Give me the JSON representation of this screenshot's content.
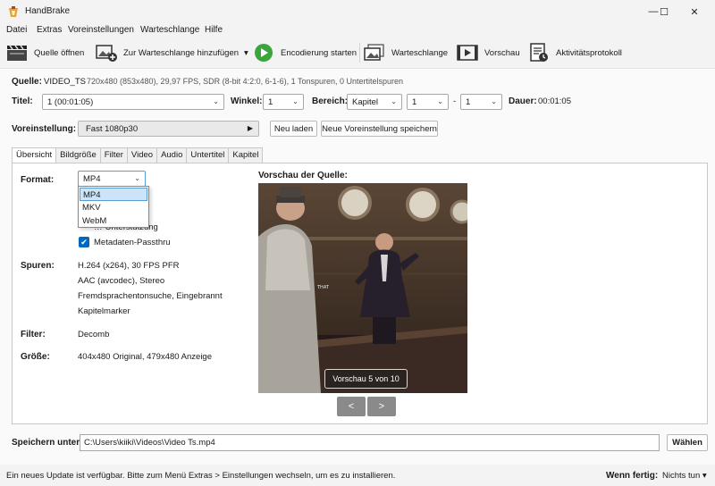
{
  "window": {
    "title": "HandBrake",
    "controls": {
      "minimize": "—",
      "maximize": "☐",
      "close": "✕"
    }
  },
  "menu": [
    "Datei",
    "Extras",
    "Voreinstellungen",
    "Warteschlange",
    "Hilfe"
  ],
  "toolbar": {
    "open_source": "Quelle öffnen",
    "add_queue": "Zur Warteschlange hinzufügen",
    "start_encode": "Encodierung starten",
    "queue": "Warteschlange",
    "preview": "Vorschau",
    "activity_log": "Aktivitätsprotokoll",
    "dropdown_arrow": "▾"
  },
  "source": {
    "label": "Quelle:",
    "name": "VIDEO_TS",
    "info": "720x480 (853x480), 29,97 FPS, SDR (8-bit 4:2:0, 6-1-6), 1 Tonspuren, 0 Untertitelspuren"
  },
  "title_row": {
    "title_label": "Titel:",
    "title_value": "1  (00:01:05)",
    "angle_label": "Winkel:",
    "angle_value": "1",
    "range_label": "Bereich:",
    "range_mode": "Kapitel",
    "range_start": "1",
    "range_sep": "-",
    "range_end": "1",
    "duration_label": "Dauer:",
    "duration_value": "00:01:05"
  },
  "preset_row": {
    "label": "Voreinstellung:",
    "value": "Fast 1080p30",
    "arrow": "▶",
    "reload": "Neu laden",
    "save_new": "Neue Voreinstellung speichern"
  },
  "tabs": [
    "Übersicht",
    "Bildgröße",
    "Filter",
    "Video",
    "Audio",
    "Untertitel",
    "Kapitel"
  ],
  "summary": {
    "format_label": "Format:",
    "format_value": "MP4",
    "format_options": [
      "MP4",
      "MKV",
      "WebM"
    ],
    "hidden_option_text": "…-Unterstützung",
    "metadata_passthru": "Metadaten-Passthru",
    "check_mark": "✔",
    "tracks_label": "Spuren:",
    "tracks": [
      "H.264 (x264), 30 FPS PFR",
      "AAC (avcodec), Stereo",
      "Fremdsprachentonsuche, Eingebrannt",
      "Kapitelmarker"
    ],
    "filter_label": "Filter:",
    "filter_value": "Decomb",
    "size_label": "Größe:",
    "size_value": "404x480 Original, 479x480 Anzeige"
  },
  "preview": {
    "heading": "Vorschau der Quelle:",
    "counter": "Vorschau 5 von 10",
    "subtitle_text": "THAT",
    "prev": "<",
    "next": ">"
  },
  "save": {
    "label": "Speichern unter:",
    "path": "C:\\Users\\kiiki\\Videos\\Video Ts.mp4",
    "browse": "Wählen"
  },
  "status": {
    "message": "Ein neues Update ist verfügbar. Bitte zum Menü Extras  > Einstellungen wechseln, um es zu installieren.",
    "when_done_label": "Wenn fertig:",
    "when_done_value": "Nichts tun",
    "arrow": "▾"
  }
}
